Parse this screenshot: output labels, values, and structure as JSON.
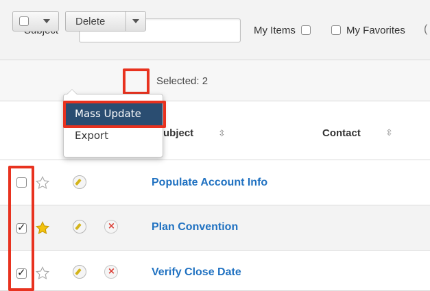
{
  "filter": {
    "subject_label": "Subject",
    "subject_value": "",
    "my_items_label": "My Items",
    "my_favorites_label": "My Favorites",
    "trailing_paren": "("
  },
  "actions": {
    "delete_label": "Delete",
    "selected_text": "Selected: 2"
  },
  "dropdown": {
    "items": [
      "Mass Update",
      "Export"
    ]
  },
  "table": {
    "columns": [
      "ubject",
      "Contact"
    ],
    "rows": [
      {
        "checked": false,
        "favorite": false,
        "show_delete": false,
        "title": "Populate Account Info"
      },
      {
        "checked": true,
        "favorite": true,
        "show_delete": true,
        "title": "Plan Convention"
      },
      {
        "checked": true,
        "favorite": false,
        "show_delete": true,
        "title": "Verify Close Date"
      }
    ]
  },
  "colors": {
    "highlight": "#e8321f",
    "link": "#1f71c1",
    "menu_active": "#2a4d71",
    "star_active": "#f2c20f"
  }
}
